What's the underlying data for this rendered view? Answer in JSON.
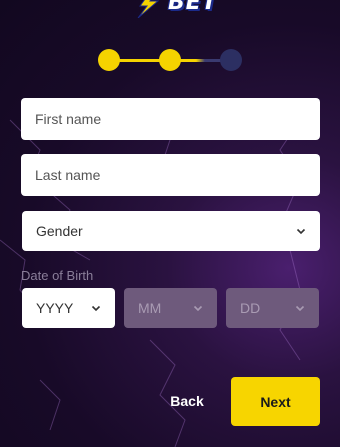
{
  "brand": {
    "logo_text": "BET",
    "accent": "#f5d300"
  },
  "stepper": {
    "total_steps": 3,
    "completed_steps": 2
  },
  "form": {
    "first_name_placeholder": "First name",
    "last_name_placeholder": "Last name",
    "gender": {
      "value": "Gender",
      "icon": "chevron-down-icon"
    },
    "dob_label": "Date of Birth",
    "dob": {
      "year": "YYYY",
      "month": "MM",
      "day": "DD"
    }
  },
  "actions": {
    "back_label": "Back",
    "next_label": "Next"
  },
  "colors": {
    "button_primary": "#f7d500",
    "disabled_select": "#6e5a7c",
    "background": "#180a28"
  }
}
